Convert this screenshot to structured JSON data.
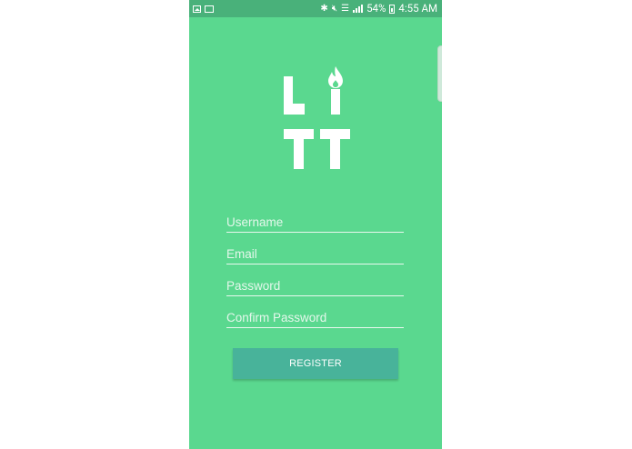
{
  "statusbar": {
    "battery_percent": "54%",
    "time": "4:55 AM",
    "icons_left": [
      "gallery-icon",
      "cc-icon"
    ],
    "icons_right": [
      "bluetooth-icon",
      "mute-icon",
      "wifi-icon",
      "signal-icon",
      "battery-icon"
    ]
  },
  "logo": {
    "name": "LiTT",
    "color": "#ffffff",
    "flame_color": "#ffffff"
  },
  "form": {
    "username_placeholder": "Username",
    "email_placeholder": "Email",
    "password_placeholder": "Password",
    "confirm_password_placeholder": "Confirm Password",
    "username_value": "",
    "email_value": "",
    "password_value": "",
    "confirm_password_value": ""
  },
  "register_button": {
    "label": "REGISTER"
  },
  "colors": {
    "background": "#5ad88f",
    "statusbar": "#49b17a",
    "button": "#48b39a"
  }
}
